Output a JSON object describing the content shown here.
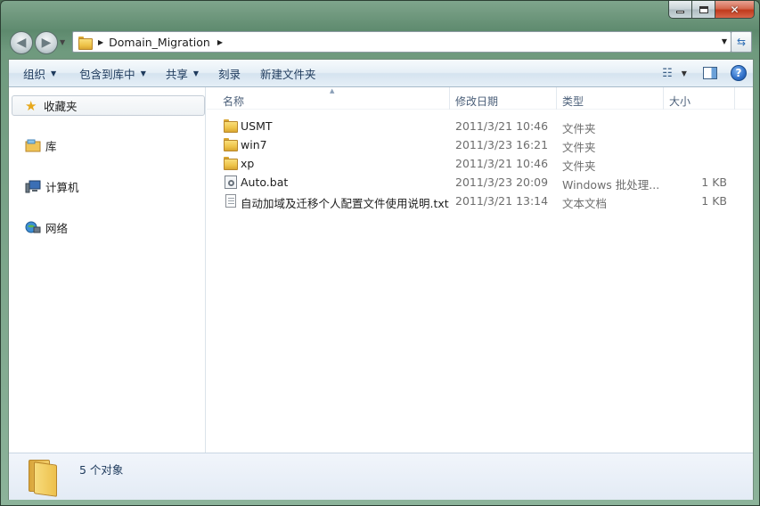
{
  "window": {
    "caption": {
      "minimize": "",
      "maximize": "",
      "close": "✕"
    }
  },
  "address": {
    "path": [
      "Domain_Migration"
    ]
  },
  "toolbar": {
    "organize": "组织",
    "include_in_library": "包含到库中",
    "share": "共享",
    "burn": "刻录",
    "new_folder": "新建文件夹",
    "help": "?"
  },
  "nav": {
    "favorites": "收藏夹",
    "libraries": "库",
    "computer": "计算机",
    "network": "网络"
  },
  "columns": {
    "name": "名称",
    "date": "修改日期",
    "type": "类型",
    "size": "大小"
  },
  "files": [
    {
      "name": "USMT",
      "date": "2011/3/21 10:46",
      "type": "文件夹",
      "size": "",
      "icon": "folder-icon"
    },
    {
      "name": "win7",
      "date": "2011/3/23 16:21",
      "type": "文件夹",
      "size": "",
      "icon": "folder-icon"
    },
    {
      "name": "xp",
      "date": "2011/3/21 10:46",
      "type": "文件夹",
      "size": "",
      "icon": "folder-icon"
    },
    {
      "name": "Auto.bat",
      "date": "2011/3/23 20:09",
      "type": "Windows 批处理...",
      "size": "1 KB",
      "icon": "batch-file-icon"
    },
    {
      "name": "自动加域及迁移个人配置文件使用说明.txt",
      "date": "2011/3/21 13:14",
      "type": "文本文档",
      "size": "1 KB",
      "icon": "text-file-icon"
    }
  ],
  "status": {
    "count": "5 个对象"
  }
}
